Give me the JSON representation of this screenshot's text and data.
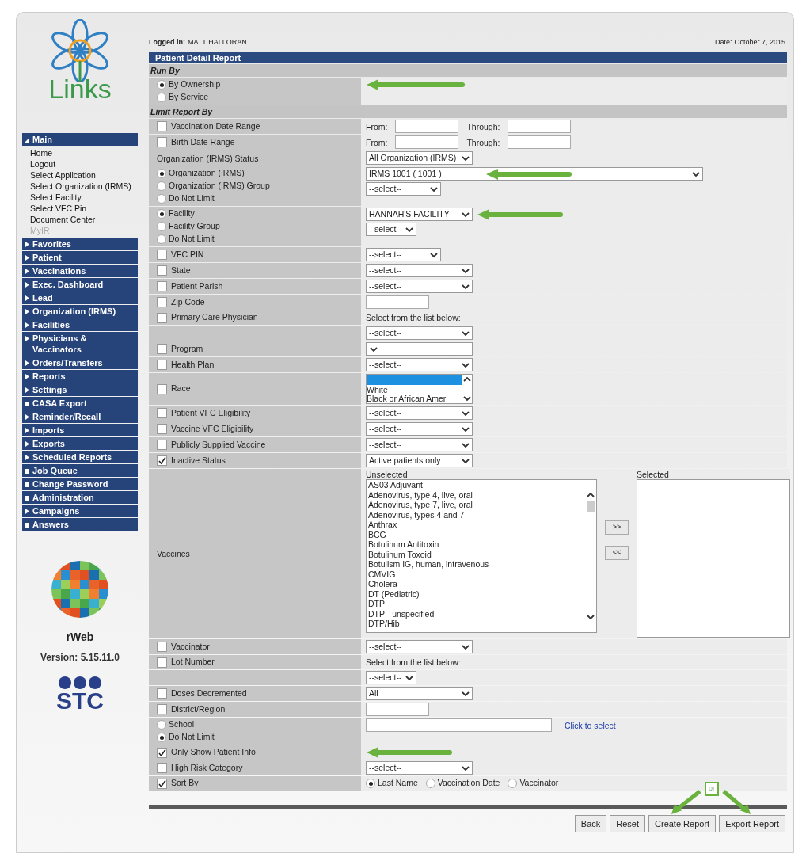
{
  "header": {
    "logged_in_label": "Logged in:",
    "user": "MATT HALLORAN",
    "date_label": "Date:",
    "date": "October 7, 2015"
  },
  "sidebar": {
    "logo_text": "Links",
    "menu": [
      {
        "label": "Main",
        "kind": "folder",
        "expanded": true,
        "children": [
          {
            "label": "Home",
            "disabled": false
          },
          {
            "label": "Logout",
            "disabled": false
          },
          {
            "label": "Select Application",
            "disabled": false
          },
          {
            "label": "Select Organization (IRMS)",
            "disabled": false
          },
          {
            "label": "Select Facility",
            "disabled": false
          },
          {
            "label": "Select VFC Pin",
            "disabled": false
          },
          {
            "label": "Document Center",
            "disabled": false
          },
          {
            "label": "MyIR",
            "disabled": true
          }
        ]
      },
      {
        "label": "Favorites",
        "kind": "folder",
        "expanded": false
      },
      {
        "label": "Patient",
        "kind": "folder",
        "expanded": false
      },
      {
        "label": "Vaccinations",
        "kind": "folder",
        "expanded": false
      },
      {
        "label": "Exec. Dashboard",
        "kind": "folder",
        "expanded": false
      },
      {
        "label": "Lead",
        "kind": "folder",
        "expanded": false
      },
      {
        "label": "Organization (IRMS)",
        "kind": "folder",
        "expanded": false
      },
      {
        "label": "Facilities",
        "kind": "folder",
        "expanded": false
      },
      {
        "label": "Physicians & Vaccinators",
        "kind": "folder",
        "expanded": false
      },
      {
        "label": "Orders/Transfers",
        "kind": "folder",
        "expanded": false
      },
      {
        "label": "Reports",
        "kind": "folder",
        "expanded": false
      },
      {
        "label": "Settings",
        "kind": "folder",
        "expanded": false
      },
      {
        "label": "CASA Export",
        "kind": "page"
      },
      {
        "label": "Reminder/Recall",
        "kind": "folder",
        "expanded": false
      },
      {
        "label": "Imports",
        "kind": "folder",
        "expanded": false
      },
      {
        "label": "Exports",
        "kind": "folder",
        "expanded": false
      },
      {
        "label": "Scheduled Reports",
        "kind": "folder",
        "expanded": false
      },
      {
        "label": "Job Queue",
        "kind": "page"
      },
      {
        "label": "Change Password",
        "kind": "page"
      },
      {
        "label": "Administration",
        "kind": "page"
      },
      {
        "label": "Campaigns",
        "kind": "folder",
        "expanded": false
      },
      {
        "label": "Answers",
        "kind": "page"
      }
    ],
    "product": "rWeb",
    "version": "Version: 5.15.11.0",
    "company": "STC"
  },
  "report": {
    "title": "Patient Detail Report",
    "rows": [
      {
        "kind": "section",
        "title": "Run By"
      },
      {
        "kind": "row",
        "left": [
          {
            "kind": "radio",
            "label": "By Ownership",
            "selected": true,
            "arrow": true
          },
          {
            "kind": "radio",
            "label": "By Service",
            "selected": false
          }
        ],
        "right": []
      },
      {
        "kind": "section",
        "title": "Limit Report By"
      },
      {
        "kind": "row",
        "left": [
          {
            "kind": "checkbox",
            "label": "Vaccination Date Range",
            "checked": false
          }
        ],
        "right": [
          [
            {
              "kind": "text",
              "text": "From:"
            },
            {
              "kind": "input"
            },
            {
              "kind": "text",
              "text": "Through:"
            },
            {
              "kind": "input"
            }
          ]
        ]
      },
      {
        "kind": "row",
        "left": [
          {
            "kind": "checkbox",
            "label": "Birth Date Range",
            "checked": false
          }
        ],
        "right": [
          [
            {
              "kind": "text",
              "text": "From:"
            },
            {
              "kind": "input"
            },
            {
              "kind": "text",
              "text": "Through:"
            },
            {
              "kind": "input"
            }
          ]
        ]
      },
      {
        "kind": "row",
        "left": [
          {
            "kind": "text",
            "text": "Organization (IRMS) Status"
          }
        ],
        "right": [
          [
            {
              "kind": "select",
              "value": "All Organization (IRMS)"
            }
          ]
        ]
      },
      {
        "kind": "row",
        "left": [
          {
            "kind": "radio",
            "label": "Organization (IRMS)",
            "selected": true
          },
          {
            "kind": "radio",
            "label": "Organization (IRMS) Group",
            "selected": false
          },
          {
            "kind": "radio",
            "label": "Do Not Limit",
            "selected": false
          }
        ],
        "right": [
          [
            {
              "kind": "wide-select",
              "value": "IRMS 1001 ( 1001 )",
              "arrow": true
            }
          ],
          [
            {
              "kind": "narrow-select",
              "value": "--select--"
            }
          ]
        ]
      },
      {
        "kind": "row",
        "left": [
          {
            "kind": "radio",
            "label": "Facility",
            "selected": true
          },
          {
            "kind": "radio",
            "label": "Facility Group",
            "selected": false
          },
          {
            "kind": "radio",
            "label": "Do Not Limit",
            "selected": false
          }
        ],
        "right": [
          [
            {
              "kind": "select",
              "value": "HANNAH'S FACILITY",
              "arrow": true
            }
          ],
          [
            {
              "kind": "short-select",
              "value": "--select--"
            }
          ]
        ]
      },
      {
        "kind": "row",
        "left": [
          {
            "kind": "checkbox",
            "label": "VFC PIN",
            "checked": false
          }
        ],
        "right": [
          [
            {
              "kind": "narrow-select",
              "value": "--select--"
            }
          ]
        ]
      },
      {
        "kind": "row",
        "left": [
          {
            "kind": "checkbox",
            "label": "State",
            "checked": false
          }
        ],
        "right": [
          [
            {
              "kind": "select",
              "value": "--select--"
            }
          ]
        ]
      },
      {
        "kind": "row",
        "left": [
          {
            "kind": "checkbox",
            "label": "Patient Parish",
            "checked": false
          }
        ],
        "right": [
          [
            {
              "kind": "select",
              "value": "--select--"
            }
          ]
        ]
      },
      {
        "kind": "row",
        "left": [
          {
            "kind": "checkbox",
            "label": "Zip Code",
            "checked": false
          }
        ],
        "right": [
          [
            {
              "kind": "input"
            }
          ]
        ]
      },
      {
        "kind": "row",
        "left": [
          {
            "kind": "checkbox",
            "label": "Primary Care Physician",
            "checked": false
          }
        ],
        "right": [
          [
            {
              "kind": "text",
              "text": "Select from the list below:"
            }
          ]
        ]
      },
      {
        "kind": "row",
        "left": [],
        "right": [
          [
            {
              "kind": "select",
              "value": "--select--"
            }
          ]
        ]
      },
      {
        "kind": "row",
        "left": [
          {
            "kind": "checkbox",
            "label": "Program",
            "checked": false
          }
        ],
        "right": [
          [
            {
              "kind": "select"
            }
          ]
        ]
      },
      {
        "kind": "row",
        "left": [
          {
            "kind": "checkbox",
            "label": "Health Plan",
            "checked": false
          }
        ],
        "right": [
          [
            {
              "kind": "select",
              "value": "--select--"
            }
          ]
        ]
      },
      {
        "kind": "row",
        "left": [
          {
            "kind": "checkbox",
            "label": "Race",
            "checked": false
          }
        ],
        "right": [
          [
            {
              "kind": "listbox",
              "blank_selected": true,
              "options": [
                "White",
                "Black or African Amer"
              ]
            }
          ]
        ]
      },
      {
        "kind": "row",
        "left": [
          {
            "kind": "checkbox",
            "label": "Patient VFC Eligibility",
            "checked": false
          }
        ],
        "right": [
          [
            {
              "kind": "select",
              "value": "--select--"
            }
          ]
        ]
      },
      {
        "kind": "row",
        "left": [
          {
            "kind": "checkbox",
            "label": "Vaccine VFC Eligibility",
            "checked": false
          }
        ],
        "right": [
          [
            {
              "kind": "select",
              "value": "--select--"
            }
          ]
        ]
      },
      {
        "kind": "row",
        "left": [
          {
            "kind": "checkbox",
            "label": "Publicly Supplied Vaccine",
            "checked": false
          }
        ],
        "right": [
          [
            {
              "kind": "select",
              "value": "--select--"
            }
          ]
        ]
      },
      {
        "kind": "row",
        "left": [
          {
            "kind": "checkbox",
            "label": "Inactive Status",
            "checked": true
          }
        ],
        "right": [
          [
            {
              "kind": "select",
              "value": "Active patients only"
            }
          ]
        ]
      },
      {
        "kind": "row",
        "left": [
          {
            "kind": "text",
            "text": "Vaccines"
          }
        ],
        "right": [
          [
            {
              "kind": "picker",
              "unselected_label": "Unselected",
              "selected_label": "Selected",
              "add": ">>",
              "remove": "<<",
              "options": [
                "AS03 Adjuvant",
                "Adenovirus, type 4, live, oral",
                "Adenovirus, type 7, live, oral",
                "Adenovirus, types 4 and 7",
                "Anthrax",
                "BCG",
                "Botulinum Antitoxin",
                "Botulinum Toxoid",
                "Botulism IG, human, intravenous",
                "CMVIG",
                "Cholera",
                "DT (Pediatric)",
                "DTP",
                "DTP - unspecified",
                "DTP/Hib"
              ]
            }
          ]
        ]
      },
      {
        "kind": "row",
        "left": [
          {
            "kind": "checkbox",
            "label": "Vaccinator",
            "checked": false
          }
        ],
        "right": [
          [
            {
              "kind": "select",
              "value": "--select--"
            }
          ]
        ]
      },
      {
        "kind": "row",
        "left": [
          {
            "kind": "checkbox",
            "label": "Lot Number",
            "checked": false
          }
        ],
        "right": [
          [
            {
              "kind": "text",
              "text": "Select from the list below:"
            }
          ]
        ]
      },
      {
        "kind": "row",
        "left": [],
        "right": [
          [
            {
              "kind": "short-select",
              "value": "--select--"
            }
          ]
        ]
      },
      {
        "kind": "row",
        "left": [
          {
            "kind": "checkbox",
            "label": "Doses Decremented",
            "checked": false
          }
        ],
        "right": [
          [
            {
              "kind": "select",
              "value": "All"
            }
          ]
        ]
      },
      {
        "kind": "row",
        "left": [
          {
            "kind": "checkbox",
            "label": "District/Region",
            "checked": false
          }
        ],
        "right": [
          [
            {
              "kind": "input"
            }
          ]
        ]
      },
      {
        "kind": "row",
        "left": [
          {
            "kind": "radio",
            "label": "School",
            "selected": false
          },
          {
            "kind": "radio",
            "label": "Do Not Limit",
            "selected": true
          }
        ],
        "right": [
          [
            {
              "kind": "wide-input"
            },
            {
              "kind": "link",
              "text": "Click to select"
            }
          ]
        ]
      },
      {
        "kind": "row",
        "left": [
          {
            "kind": "checkbox",
            "label": "Only Show Patient Info",
            "checked": true,
            "arrow": true
          }
        ],
        "right": []
      },
      {
        "kind": "row",
        "left": [
          {
            "kind": "checkbox",
            "label": "High Risk Category",
            "checked": false
          }
        ],
        "right": [
          [
            {
              "kind": "select",
              "value": "--select--"
            }
          ]
        ]
      },
      {
        "kind": "row",
        "left": [
          {
            "kind": "checkbox",
            "label": "Sort By",
            "checked": true
          }
        ],
        "right": [
          [
            {
              "kind": "radio",
              "label": "Last Name",
              "selected": true
            },
            {
              "kind": "radio",
              "label": "Vaccination Date",
              "selected": false
            },
            {
              "kind": "radio",
              "label": "Vaccinator",
              "selected": false
            }
          ]
        ]
      }
    ],
    "buttons": [
      "Back",
      "Reset",
      "Create Report",
      "Export Report"
    ],
    "note": "or"
  }
}
